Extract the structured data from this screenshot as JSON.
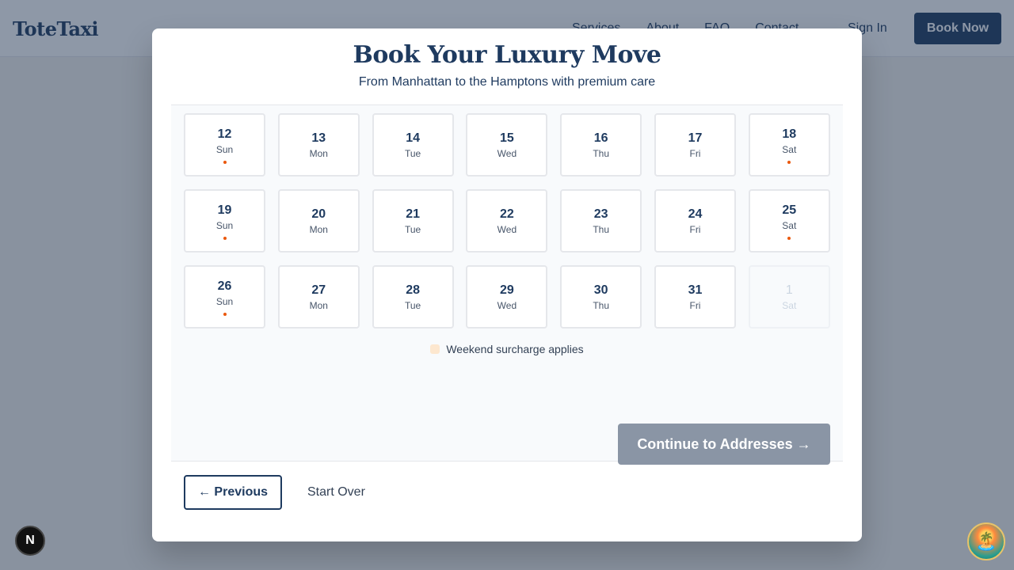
{
  "site": {
    "logo": "ToteTaxi",
    "nav": [
      "Services",
      "About",
      "FAQ",
      "Contact"
    ],
    "sign_in": "Sign In",
    "book_now": "Book Now"
  },
  "modal": {
    "title": "Book Your Luxury Move",
    "subtitle": "From Manhattan to the Hamptons with premium care",
    "days": [
      {
        "num": "12",
        "dow": "Sun",
        "weekend": true,
        "disabled": false
      },
      {
        "num": "13",
        "dow": "Mon",
        "weekend": false,
        "disabled": false
      },
      {
        "num": "14",
        "dow": "Tue",
        "weekend": false,
        "disabled": false
      },
      {
        "num": "15",
        "dow": "Wed",
        "weekend": false,
        "disabled": false
      },
      {
        "num": "16",
        "dow": "Thu",
        "weekend": false,
        "disabled": false
      },
      {
        "num": "17",
        "dow": "Fri",
        "weekend": false,
        "disabled": false
      },
      {
        "num": "18",
        "dow": "Sat",
        "weekend": true,
        "disabled": false
      },
      {
        "num": "19",
        "dow": "Sun",
        "weekend": true,
        "disabled": false
      },
      {
        "num": "20",
        "dow": "Mon",
        "weekend": false,
        "disabled": false
      },
      {
        "num": "21",
        "dow": "Tue",
        "weekend": false,
        "disabled": false
      },
      {
        "num": "22",
        "dow": "Wed",
        "weekend": false,
        "disabled": false
      },
      {
        "num": "23",
        "dow": "Thu",
        "weekend": false,
        "disabled": false
      },
      {
        "num": "24",
        "dow": "Fri",
        "weekend": false,
        "disabled": false
      },
      {
        "num": "25",
        "dow": "Sat",
        "weekend": true,
        "disabled": false
      },
      {
        "num": "26",
        "dow": "Sun",
        "weekend": true,
        "disabled": false
      },
      {
        "num": "27",
        "dow": "Mon",
        "weekend": false,
        "disabled": false
      },
      {
        "num": "28",
        "dow": "Tue",
        "weekend": false,
        "disabled": false
      },
      {
        "num": "29",
        "dow": "Wed",
        "weekend": false,
        "disabled": false
      },
      {
        "num": "30",
        "dow": "Thu",
        "weekend": false,
        "disabled": false
      },
      {
        "num": "31",
        "dow": "Fri",
        "weekend": false,
        "disabled": false
      },
      {
        "num": "1",
        "dow": "Sat",
        "weekend": false,
        "disabled": true
      }
    ],
    "legend": "Weekend surcharge applies",
    "continue_label": "Continue to Addresses →",
    "previous_label": "← Previous",
    "start_over_label": "Start Over"
  },
  "widgets": {
    "next_badge": "N",
    "avatar_emoji": "🏝️"
  },
  "colors": {
    "primary": "#1e3a5f",
    "weekend_dot": "#ea580c",
    "legend_swatch": "#fde7cf",
    "continue_disabled": "#8a95a5"
  }
}
